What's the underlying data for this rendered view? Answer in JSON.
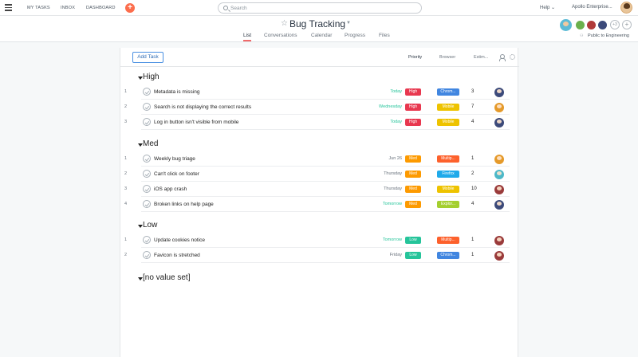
{
  "nav": {
    "my_tasks": "MY TASKS",
    "inbox": "INBOX",
    "dashboard": "DASHBOARD",
    "add": "+"
  },
  "search": {
    "placeholder": "Search"
  },
  "account": {
    "help": "Help ⌄",
    "org": "Apollo Enterprise..."
  },
  "project": {
    "title": "Bug Tracking",
    "tabs": [
      "List",
      "Conversations",
      "Calendar",
      "Progress",
      "Files"
    ],
    "active_tab": "List",
    "members_more": "+3",
    "add_member": "+",
    "visibility": "Public to Engineering"
  },
  "toolbar": {
    "add_task": "Add Task",
    "col_priority": "Priority",
    "col_browser": "Browser",
    "col_estimate": "Estim..."
  },
  "colors": {
    "high": "#e8384f",
    "med": "#fd9a00",
    "low": "#25c49a",
    "chrome": "#4186e0",
    "mobile": "#eec300",
    "multiple": "#fd612c",
    "firefox": "#20aaea",
    "explorer": "#a4cf30",
    "accent": "#f06a6a"
  },
  "sections": [
    {
      "title": "High",
      "tasks": [
        {
          "num": "1",
          "name": "Metadata is missing",
          "due": "Today",
          "due_green": true,
          "priority": "High",
          "priority_color": "#e8384f",
          "browser": "Chrom...",
          "browser_color": "#4186e0",
          "estimate": "3",
          "avatar": "#3c4a7a"
        },
        {
          "num": "2",
          "name": "Search is not displaying the correct results",
          "due": "Wednesday",
          "due_green": true,
          "priority": "High",
          "priority_color": "#e8384f",
          "browser": "Mobile",
          "browser_color": "#eec300",
          "estimate": "7",
          "avatar": "#e59a2a"
        },
        {
          "num": "3",
          "name": "Log in button isn't visible from mobile",
          "due": "Today",
          "due_green": true,
          "priority": "High",
          "priority_color": "#e8384f",
          "browser": "Mobile",
          "browser_color": "#eec300",
          "estimate": "4",
          "avatar": "#3c4a7a"
        }
      ]
    },
    {
      "title": "Med",
      "tasks": [
        {
          "num": "1",
          "name": "Weekly bug triage",
          "due": "Jun 26",
          "due_green": false,
          "priority": "Med",
          "priority_color": "#fd9a00",
          "browser": "Multip...",
          "browser_color": "#fd612c",
          "estimate": "1",
          "avatar": "#e59a2a"
        },
        {
          "num": "2",
          "name": "Can't click on footer",
          "due": "Thursday",
          "due_green": false,
          "priority": "Med",
          "priority_color": "#fd9a00",
          "browser": "Firefox",
          "browser_color": "#20aaea",
          "estimate": "2",
          "avatar": "#4db8c8"
        },
        {
          "num": "3",
          "name": "iOS app crash",
          "due": "Thursday",
          "due_green": false,
          "priority": "Med",
          "priority_color": "#fd9a00",
          "browser": "Mobile",
          "browser_color": "#eec300",
          "estimate": "10",
          "avatar": "#9a3b3b"
        },
        {
          "num": "4",
          "name": "Broken links on help page",
          "due": "Tomorrow",
          "due_green": true,
          "priority": "Med",
          "priority_color": "#fd9a00",
          "browser": "Explor...",
          "browser_color": "#a4cf30",
          "estimate": "4",
          "avatar": "#3c4a7a"
        }
      ]
    },
    {
      "title": "Low",
      "tasks": [
        {
          "num": "1",
          "name": "Update cookies notice",
          "due": "Tomorrow",
          "due_green": true,
          "priority": "Low",
          "priority_color": "#25c49a",
          "browser": "Multip...",
          "browser_color": "#fd612c",
          "estimate": "1",
          "avatar": "#9a3b3b"
        },
        {
          "num": "2",
          "name": "Favicon is stretched",
          "due": "Friday",
          "due_green": false,
          "priority": "Low",
          "priority_color": "#25c49a",
          "browser": "Chrom...",
          "browser_color": "#4186e0",
          "estimate": "1",
          "avatar": "#9a3b3b"
        }
      ]
    },
    {
      "title": "[no value set]",
      "tasks": []
    }
  ]
}
